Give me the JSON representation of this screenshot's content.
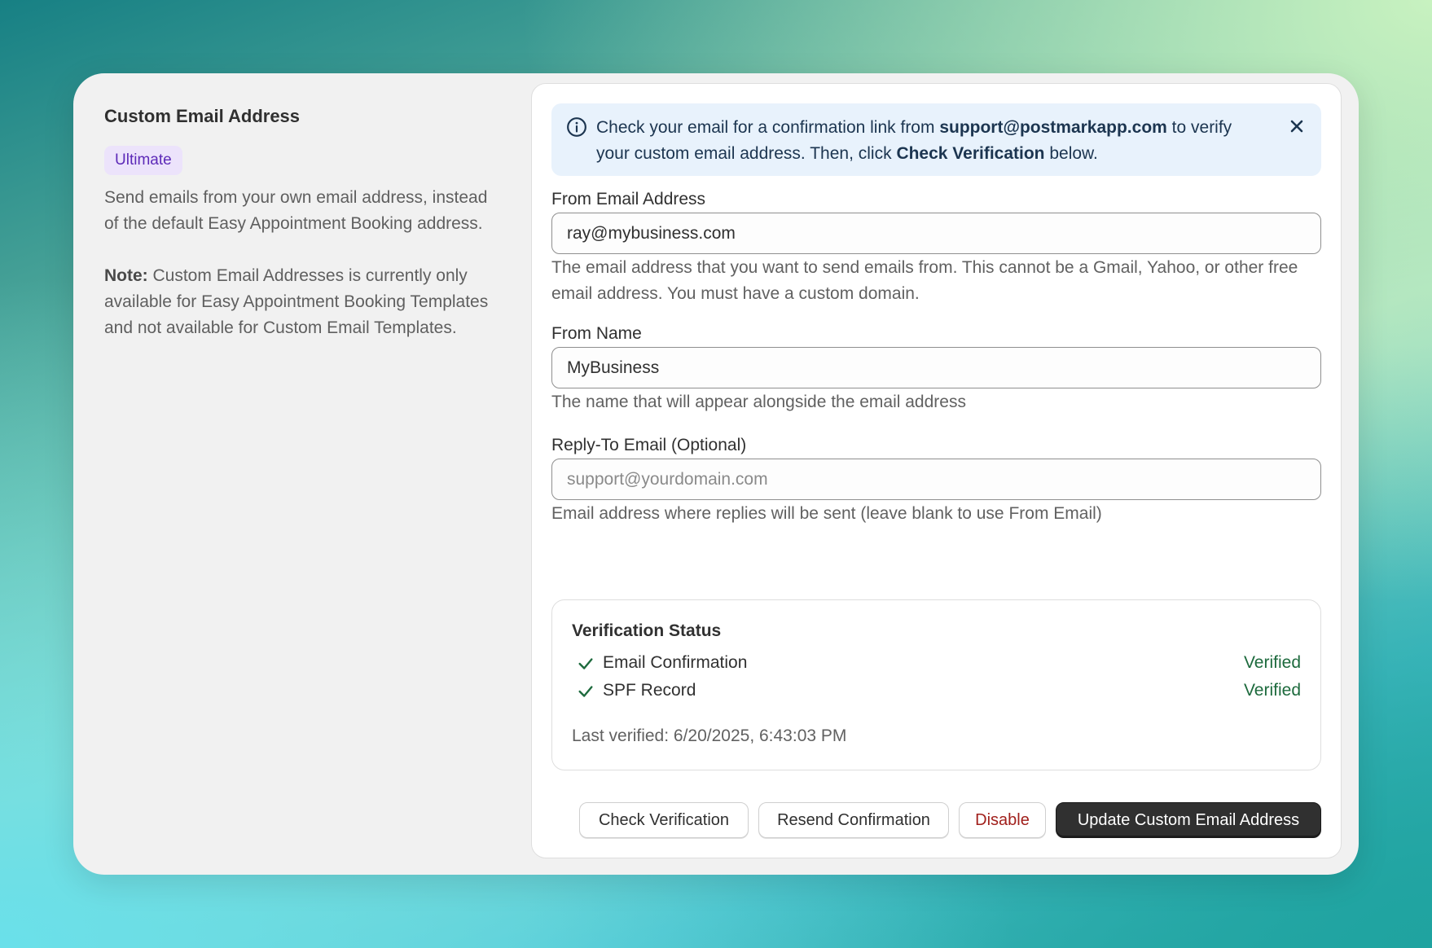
{
  "sidebar": {
    "title": "Custom Email Address",
    "badge": "Ultimate",
    "description": "Send emails from your own email address, instead of the default Easy Appointment Booking address.",
    "note_label": "Note:",
    "note_text": " Custom Email Addresses is currently only available for Easy Appointment Booking Templates and not available for Custom Email Templates."
  },
  "banner": {
    "text_1": "Check your email for a confirmation link from ",
    "email": "support@postmarkapp.com",
    "text_2": " to verify your custom email address. Then, click ",
    "action": "Check Verification",
    "text_3": " below.",
    "info_icon": "info-circle-icon",
    "close_icon": "close-icon"
  },
  "form": {
    "from_email": {
      "label": "From Email Address",
      "value": "ray@mybusiness.com",
      "help": "The email address that you want to send emails from. This cannot be a Gmail, Yahoo, or other free email address. You must have a custom domain."
    },
    "from_name": {
      "label": "From Name",
      "value": "MyBusiness",
      "help": "The name that will appear alongside the email address"
    },
    "reply_to": {
      "label": "Reply-To Email (Optional)",
      "value": "",
      "placeholder": "support@yourdomain.com",
      "help": "Email address where replies will be sent (leave blank to use From Email)"
    }
  },
  "verification": {
    "title": "Verification Status",
    "items": [
      {
        "name": "Email Confirmation",
        "status": "Verified",
        "icon": "checkmark-icon"
      },
      {
        "name": "SPF Record",
        "status": "Verified",
        "icon": "checkmark-icon"
      }
    ],
    "last_verified": "Last verified: 6/20/2025, 6:43:03 PM"
  },
  "actions": {
    "check": "Check Verification",
    "resend": "Resend Confirmation",
    "disable": "Disable",
    "update": "Update Custom Email Address"
  },
  "colors": {
    "accent_dark": "#303030",
    "verified_green": "#1d6a3d",
    "danger_red": "#a1201c",
    "badge_purple": "#5d2ab8",
    "banner_bg": "#e8f2fc"
  }
}
